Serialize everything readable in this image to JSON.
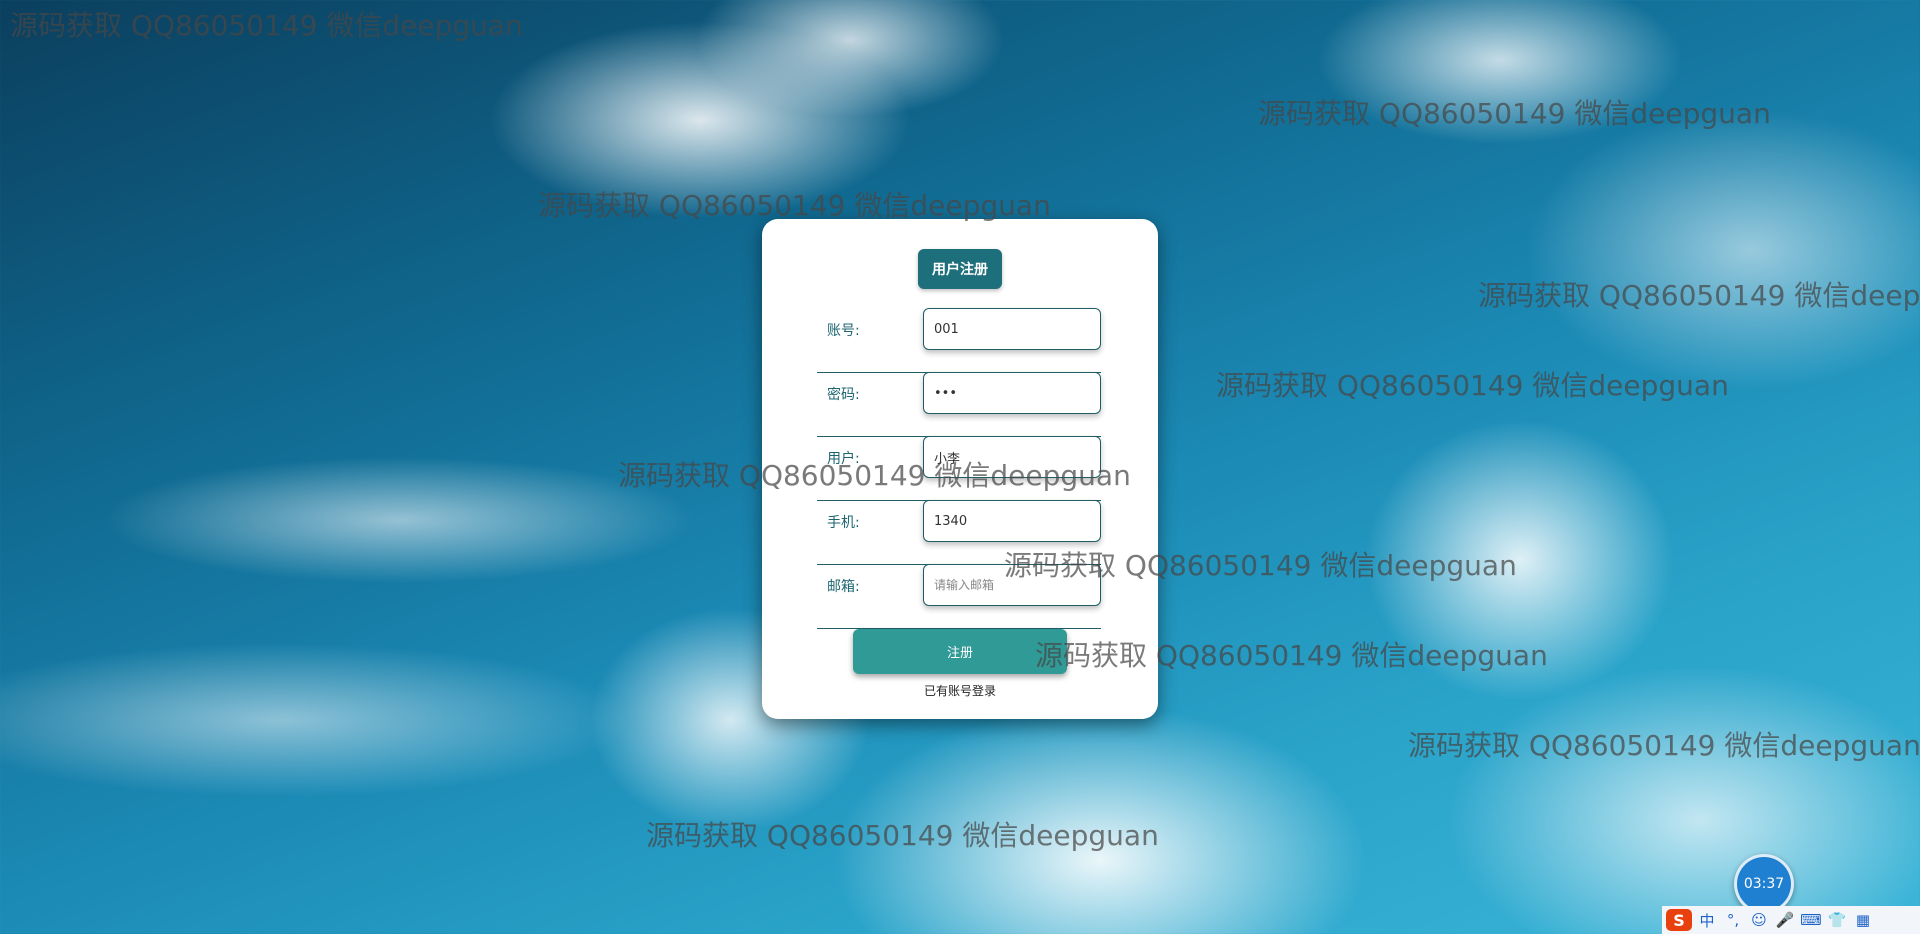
{
  "watermark": "源码获取 QQ86050149 微信deepguan",
  "form": {
    "title": "用户注册",
    "fields": [
      {
        "label": "账号:",
        "value": "001",
        "placeholder": "",
        "type": "text"
      },
      {
        "label": "密码:",
        "value": "•••",
        "placeholder": "",
        "type": "text"
      },
      {
        "label": "用户:",
        "value": "小李",
        "placeholder": "",
        "type": "text"
      },
      {
        "label": "手机:",
        "value": "1340",
        "placeholder": "",
        "type": "text"
      },
      {
        "label": "邮箱:",
        "value": "",
        "placeholder": "请输入邮箱",
        "type": "text"
      }
    ],
    "submit_label": "注册",
    "login_link": "已有账号登录"
  },
  "clock": {
    "time": "03:37"
  },
  "ime": {
    "logo": "S",
    "items": [
      "中",
      "°,",
      "☺",
      "🎤",
      "⌨",
      "👕",
      "▦"
    ]
  },
  "colors": {
    "accent": "#1d6f7b",
    "button": "#2f9a96",
    "clock_bg": "#1f7fd0",
    "ime_logo": "#e8410e"
  }
}
